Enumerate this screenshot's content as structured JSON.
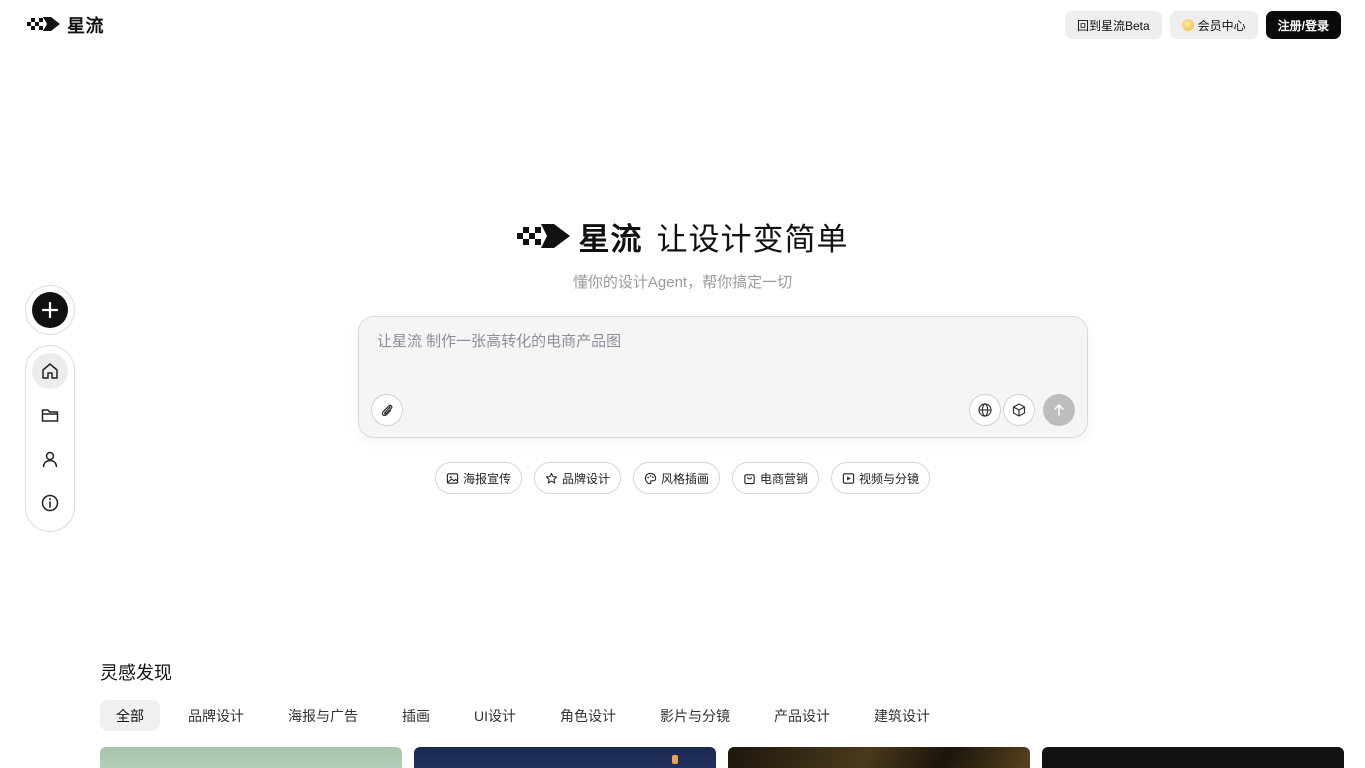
{
  "brand": {
    "name": "星流",
    "slogan": "让设计变简单"
  },
  "header": {
    "back_label": "回到星流Beta",
    "vip_label": "会员中心",
    "login_label": "注册/登录"
  },
  "sidebar": {
    "items": [
      {
        "icon": "home-icon"
      },
      {
        "icon": "folder-icon"
      },
      {
        "icon": "user-icon"
      },
      {
        "icon": "info-icon"
      }
    ]
  },
  "hero": {
    "subtitle": "懂你的设计Agent，帮你搞定一切"
  },
  "prompt": {
    "placeholder": "让星流 制作一张高转化的电商产品图",
    "value": ""
  },
  "chips": [
    {
      "label": "海报宣传",
      "icon": "image-icon"
    },
    {
      "label": "品牌设计",
      "icon": "star-icon"
    },
    {
      "label": "风格插画",
      "icon": "palette-icon"
    },
    {
      "label": "电商营销",
      "icon": "shopping-bag-icon"
    },
    {
      "label": "视频与分镜",
      "icon": "play-icon"
    }
  ],
  "inspiration": {
    "title": "灵感发现",
    "tabs": [
      "全部",
      "品牌设计",
      "海报与广告",
      "插画",
      "UI设计",
      "角色设计",
      "影片与分镜",
      "产品设计",
      "建筑设计"
    ],
    "active_tab": "全部"
  },
  "colors": {
    "accent": "#0a0a0a",
    "muted_text": "#9a9a9a",
    "card_1": "#a6c4ad",
    "card_2": "#1b2a52",
    "card_3": "#3a2e18",
    "card_4": "#121212"
  }
}
